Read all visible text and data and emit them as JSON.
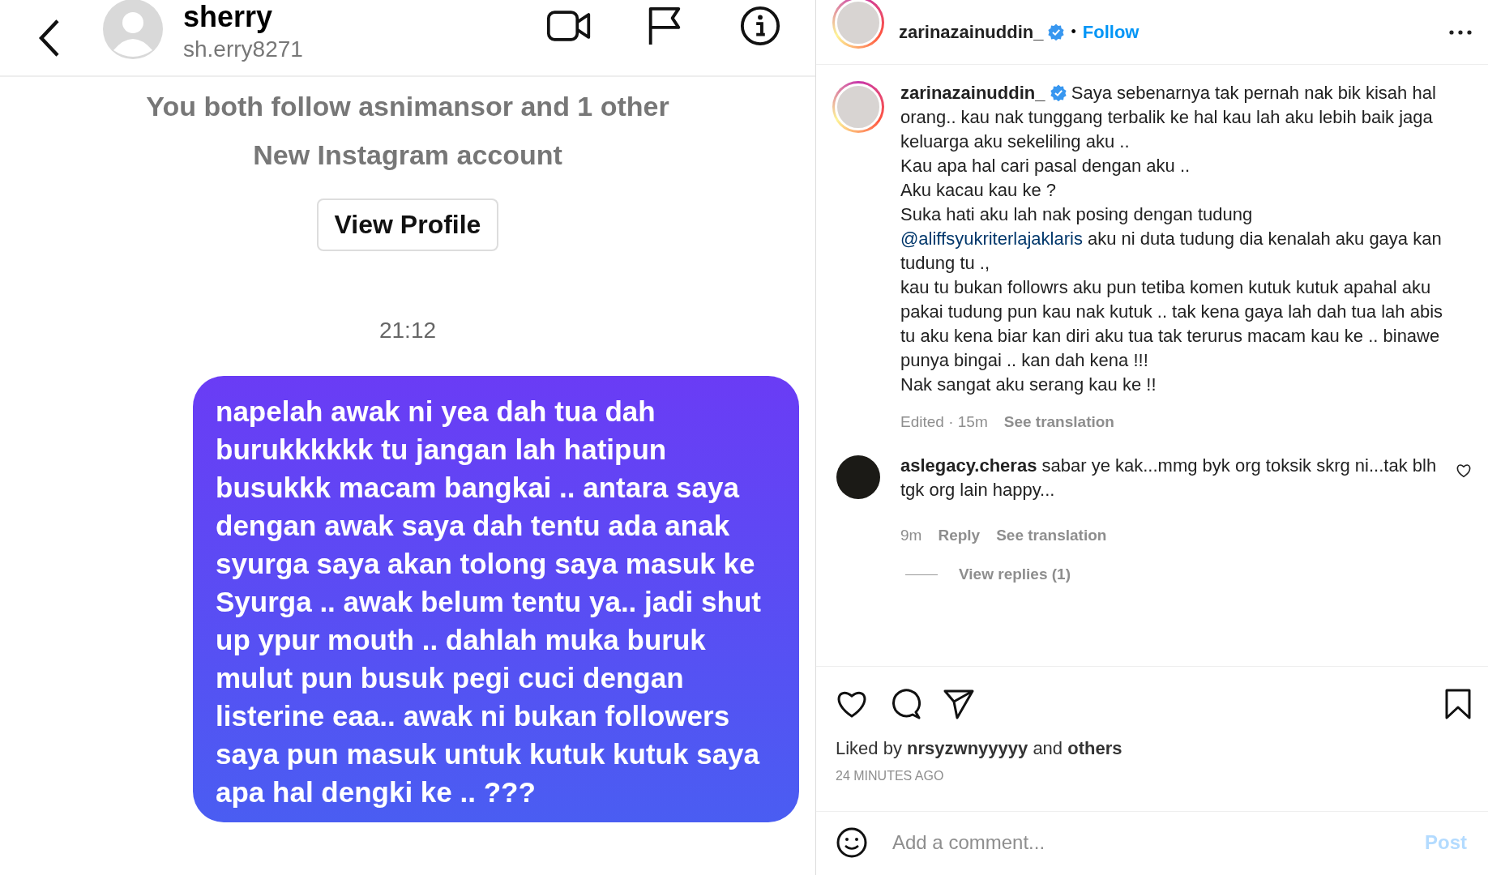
{
  "dm": {
    "header": {
      "name": "sherry",
      "handle": "sh.erry8271"
    },
    "mutuals": "You both follow asnimansor and 1 other",
    "account_note": "New Instagram account",
    "view_profile": "View Profile",
    "time": "21:12",
    "message": "napelah awak ni yea dah tua dah burukkkkkk tu jangan lah hatipun busukkk macam bangkai .. antara saya dengan awak saya dah tentu ada anak syurga saya akan tolong saya masuk ke Syurga .. awak belum tentu ya.. jadi shut up ypur mouth .. dahlah muka buruk  mulut pun busuk pegi cuci dengan listerine eaa.. awak ni bukan followers saya  pun masuk untuk kutuk kutuk saya apa hal dengki ke .. ???"
  },
  "post": {
    "header": {
      "username": "zarinazainuddin_",
      "separator": "•",
      "follow": "Follow"
    },
    "caption": {
      "username": "zarinazainuddin_",
      "text_before": "Saya sebenarnya tak pernah nak bik kisah hal orang.. kau nak tunggang terbalik ke hal kau lah aku lebih baik jaga keluarga aku sekeliling aku ..\nKau apa hal cari pasal dengan aku ..\nAku kacau kau ke ?\nSuka hati aku lah nak posing dengan tudung\n",
      "mention": "@aliffsyukriterlajaklaris",
      "text_after": " aku ni duta tudung dia kenalah aku gaya kan tudung tu .,\nkau tu bukan followrs aku pun tetiba komen kutuk kutuk apahal aku pakai tudung pun kau nak kutuk .. tak kena gaya lah dah tua lah abis tu aku kena biar kan diri aku tua tak terurus macam kau ke .. binawe punya bingai .. kan dah kena !!!\nNak sangat aku serang kau ke !!",
      "edited": "Edited · 15m",
      "see_translation": "See translation"
    },
    "comments": [
      {
        "text": "**aslegacy.cheras** sabar ye kak...mmg byk org toksik skrg ni...tak blh tgk org lain happy...",
        "age": "9m",
        "reply": "Reply",
        "see_translation": "See translation",
        "view_replies": "View replies (1)"
      }
    ],
    "liked_by": "Liked by **nrsyzwnyyyyy** and **others**",
    "posted": "24 MINUTES AGO",
    "comment_field": {
      "placeholder": "Add a comment..."
    },
    "post_button": {
      "label": "Post",
      "disabled": true
    }
  }
}
